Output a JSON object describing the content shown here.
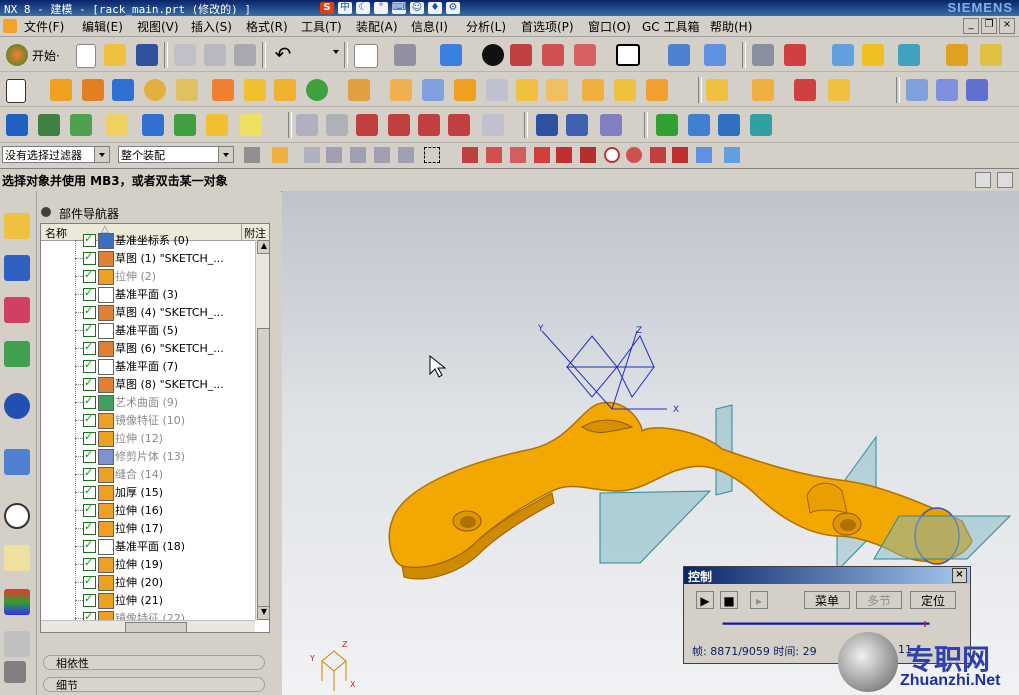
{
  "window": {
    "title": "NX 8 - 建模 - [rack_main.prt (修改的) ]",
    "brand": "SIEMENS"
  },
  "menu": [
    {
      "label": "文件(F)"
    },
    {
      "label": "编辑(E)"
    },
    {
      "label": "视图(V)"
    },
    {
      "label": "插入(S)"
    },
    {
      "label": "格式(R)"
    },
    {
      "label": "工具(T)"
    },
    {
      "label": "装配(A)"
    },
    {
      "label": "信息(I)"
    },
    {
      "label": "分析(L)"
    },
    {
      "label": "首选项(P)"
    },
    {
      "label": "窗口(O)"
    },
    {
      "label": "GC 工具箱"
    },
    {
      "label": "帮助(H)"
    }
  ],
  "toolbar": {
    "start_label": "开始·"
  },
  "filter": {
    "selection_filter": "没有选择过滤器",
    "scope": "整个装配"
  },
  "status": {
    "prompt": "选择对象并使用 MB3，或者双击某一对象"
  },
  "navigator": {
    "title": "部件导航器",
    "col_name": "名称",
    "col_attached": "附注",
    "items": [
      {
        "label": "基准坐标系 (0)",
        "gray": false
      },
      {
        "label": "草图 (1) \"SKETCH_...",
        "gray": false
      },
      {
        "label": "拉伸 (2)",
        "gray": true
      },
      {
        "label": "基准平面 (3)",
        "gray": false
      },
      {
        "label": "草图 (4) \"SKETCH_...",
        "gray": false
      },
      {
        "label": "基准平面 (5)",
        "gray": false
      },
      {
        "label": "草图 (6) \"SKETCH_...",
        "gray": false
      },
      {
        "label": "基准平面 (7)",
        "gray": false
      },
      {
        "label": "草图 (8) \"SKETCH_...",
        "gray": false
      },
      {
        "label": "艺术曲面 (9)",
        "gray": true
      },
      {
        "label": "镜像特征 (10)",
        "gray": true
      },
      {
        "label": "拉伸 (12)",
        "gray": true
      },
      {
        "label": "修剪片体 (13)",
        "gray": true
      },
      {
        "label": "缝合 (14)",
        "gray": true
      },
      {
        "label": "加厚 (15)",
        "gray": false
      },
      {
        "label": "拉伸 (16)",
        "gray": false
      },
      {
        "label": "拉伸 (17)",
        "gray": false
      },
      {
        "label": "基准平面 (18)",
        "gray": false
      },
      {
        "label": "拉伸 (19)",
        "gray": false
      },
      {
        "label": "拉伸 (20)",
        "gray": false
      },
      {
        "label": "拉伸 (21)",
        "gray": false
      },
      {
        "label": "镜像特征 (22)",
        "gray": true
      }
    ],
    "panel_dependencies": "相依性",
    "panel_details": "细节"
  },
  "viewport": {
    "axis_x": "X",
    "axis_y": "Y",
    "axis_z": "Z",
    "triad_x": "X",
    "triad_y": "Y",
    "triad_z": "Z",
    "part_color": "#f2a800"
  },
  "control_dialog": {
    "title": "控制",
    "menu_button": "菜单",
    "multi_button": "多节",
    "locate_button": "定位",
    "frame_label": "帧: 8871/9059 时间: 29",
    "frame_tail": "11",
    "progress": 0.979
  },
  "watermark": {
    "site_cn": "专职网",
    "site_url": "Zhuanzhi.Net"
  }
}
